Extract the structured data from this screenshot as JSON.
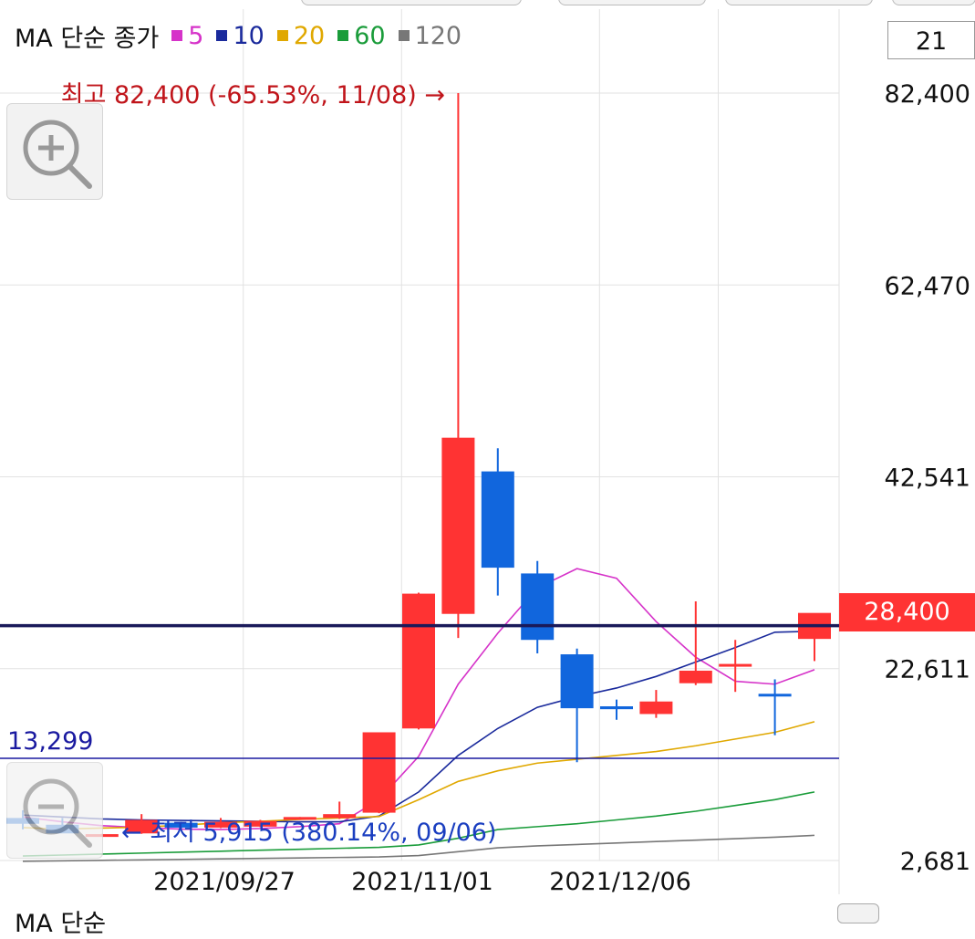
{
  "legend": {
    "title": "MA 단순 종가",
    "items": [
      {
        "label": "5",
        "color": "#d633c9"
      },
      {
        "label": "10",
        "color": "#1a2a9c"
      },
      {
        "label": "20",
        "color": "#e0a800"
      },
      {
        "label": "60",
        "color": "#1a9c3a"
      },
      {
        "label": "120",
        "color": "#777777"
      }
    ]
  },
  "period_input": "21",
  "bottom_legend": "MA 단순 ",
  "chart_data": {
    "type": "candlestick",
    "y_ticks": [
      "82,400",
      "62,470",
      "42,541",
      "22,611",
      "2,681"
    ],
    "x_ticks": [
      "2021/09/27",
      "2021/11/01",
      "2021/12/06"
    ],
    "ylim": [
      2681,
      82400
    ],
    "current_price": "28,400",
    "current_value": 28400,
    "high_label": "최고 82,400 (-65.53%, 11/08) →",
    "low_label": "← 최저 5,915 (380.14%, 09/06)",
    "ref_label": "13,299",
    "ref_value": 13299,
    "colors": {
      "up": "#ff3333",
      "down": "#1166dd",
      "ref_line": "#1a1aa0",
      "current_line": "#1a1a5a",
      "high": "#c0141a",
      "low": "#1a3ec0"
    },
    "candles": [
      {
        "o": 7100,
        "h": 7900,
        "l": 5915,
        "c": 6500
      },
      {
        "o": 6400,
        "h": 7100,
        "l": 6050,
        "c": 5500
      },
      {
        "o": 5400,
        "h": 5450,
        "l": 5350,
        "c": 5420
      },
      {
        "o": 5500,
        "h": 7500,
        "l": 5450,
        "c": 6900
      },
      {
        "o": 6600,
        "h": 6700,
        "l": 6000,
        "c": 6100
      },
      {
        "o": 6100,
        "h": 7100,
        "l": 6050,
        "c": 6700
      },
      {
        "o": 6200,
        "h": 6900,
        "l": 6150,
        "c": 6800
      },
      {
        "o": 7000,
        "h": 7200,
        "l": 6900,
        "c": 7200
      },
      {
        "o": 7100,
        "h": 8800,
        "l": 7000,
        "c": 7500
      },
      {
        "o": 7650,
        "h": 16000,
        "l": 7600,
        "c": 16000
      },
      {
        "o": 16400,
        "h": 30500,
        "l": 16300,
        "c": 30400
      },
      {
        "o": 28300,
        "h": 82400,
        "l": 25800,
        "c": 46600
      },
      {
        "o": 43100,
        "h": 45500,
        "l": 30200,
        "c": 33100
      },
      {
        "o": 32500,
        "h": 33800,
        "l": 24200,
        "c": 25600
      },
      {
        "o": 24100,
        "h": 24700,
        "l": 12900,
        "c": 18500
      },
      {
        "o": 18700,
        "h": 19400,
        "l": 17300,
        "c": 18400
      },
      {
        "o": 17900,
        "h": 20400,
        "l": 17500,
        "c": 19200
      },
      {
        "o": 21100,
        "h": 29600,
        "l": 20900,
        "c": 22400
      },
      {
        "o": 23000,
        "h": 25600,
        "l": 20200,
        "c": 23100
      },
      {
        "o": 20000,
        "h": 21500,
        "l": 15700,
        "c": 19800
      },
      {
        "o": 25700,
        "h": 28300,
        "l": 23400,
        "c": 28400
      }
    ],
    "ma_series": [
      {
        "label": "5",
        "values": [
          7200,
          6700,
          6300,
          6100,
          5950,
          5900,
          6000,
          6200,
          6500,
          9000,
          13500,
          21000,
          26300,
          31000,
          33000,
          32000,
          27500,
          23800,
          21300,
          21000,
          22500
        ]
      },
      {
        "label": "10",
        "values": [
          7400,
          7200,
          7000,
          6900,
          6850,
          6800,
          6750,
          6700,
          6700,
          7300,
          9800,
          13600,
          16400,
          18600,
          19700,
          20600,
          21800,
          23300,
          24800,
          26400,
          26500
        ]
      },
      {
        "label": "20",
        "values": [
          6100,
          5950,
          6050,
          6150,
          6350,
          6600,
          6750,
          6950,
          7100,
          7250,
          9000,
          10900,
          12000,
          12800,
          13200,
          13600,
          14000,
          14600,
          15300,
          16000,
          17100
        ]
      },
      {
        "label": "60",
        "values": [
          3150,
          3250,
          3350,
          3450,
          3550,
          3650,
          3750,
          3850,
          3950,
          4050,
          4300,
          5000,
          5900,
          6200,
          6500,
          6900,
          7300,
          7800,
          8400,
          9000,
          9800
        ]
      },
      {
        "label": "120",
        "values": [
          2600,
          2650,
          2700,
          2750,
          2800,
          2850,
          2900,
          2950,
          3000,
          3050,
          3200,
          3600,
          4000,
          4200,
          4350,
          4500,
          4650,
          4800,
          4950,
          5100,
          5300
        ]
      }
    ]
  }
}
